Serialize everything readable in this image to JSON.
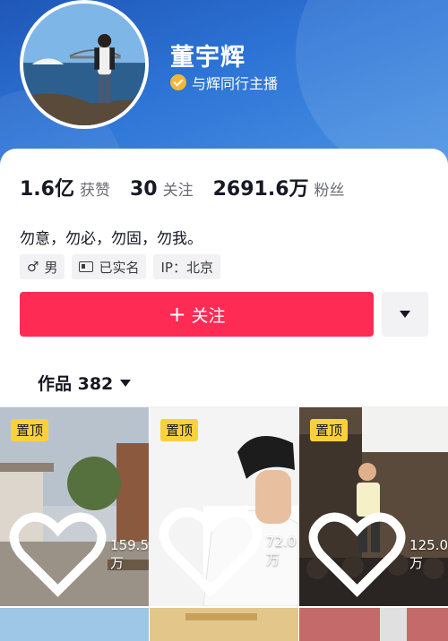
{
  "profile": {
    "name": "董宇辉",
    "verify_text": "与辉同行主播",
    "bio": "勿意，勿必，勿固，勿我。"
  },
  "stats": [
    {
      "value": "1.6亿",
      "label": "获赞"
    },
    {
      "value": "30",
      "label": "关注"
    },
    {
      "value": "2691.6万",
      "label": "粉丝"
    }
  ],
  "tags": {
    "gender": "男",
    "gender_icon": "♂",
    "verified": "已实名",
    "ip": "IP：北京"
  },
  "actions": {
    "follow_label": "关注",
    "follow_icon": "+"
  },
  "works": {
    "tab_label": "作品 382",
    "items": [
      {
        "pinned": "置顶",
        "likes": "159.5万"
      },
      {
        "pinned": "置顶",
        "likes": "72.0万"
      },
      {
        "pinned": "置顶",
        "likes": "125.0万"
      }
    ]
  },
  "colors": {
    "accent": "#fe2c55",
    "header": "#2d74d6",
    "pin": "#fbd13b"
  }
}
